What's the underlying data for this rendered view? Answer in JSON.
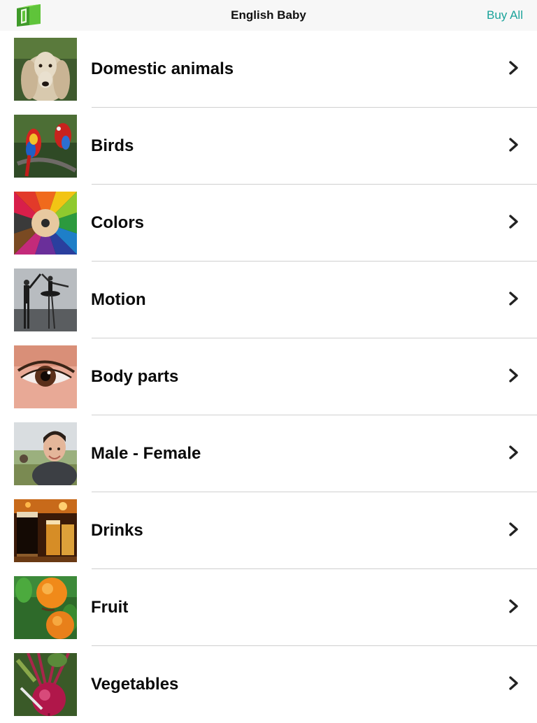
{
  "navbar": {
    "title": "English Baby",
    "buy_all": "Buy All",
    "logo_icon": "green-book-icon"
  },
  "colors": {
    "accent": "#1aa39a",
    "navbar_bg": "#f7f7f7",
    "divider": "#cfcfcf"
  },
  "categories": [
    {
      "label": "Domestic animals",
      "thumbnail": "afghan-hound-photo"
    },
    {
      "label": "Birds",
      "thumbnail": "parrots-photo"
    },
    {
      "label": "Colors",
      "thumbnail": "colored-pencils-photo"
    },
    {
      "label": "Motion",
      "thumbnail": "ballet-dancers-photo"
    },
    {
      "label": "Body parts",
      "thumbnail": "eye-photo"
    },
    {
      "label": "Male - Female",
      "thumbnail": "man-portrait-photo"
    },
    {
      "label": "Drinks",
      "thumbnail": "beer-glasses-photo"
    },
    {
      "label": "Fruit",
      "thumbnail": "apricots-photo"
    },
    {
      "label": "Vegetables",
      "thumbnail": "beetroot-photo"
    }
  ]
}
